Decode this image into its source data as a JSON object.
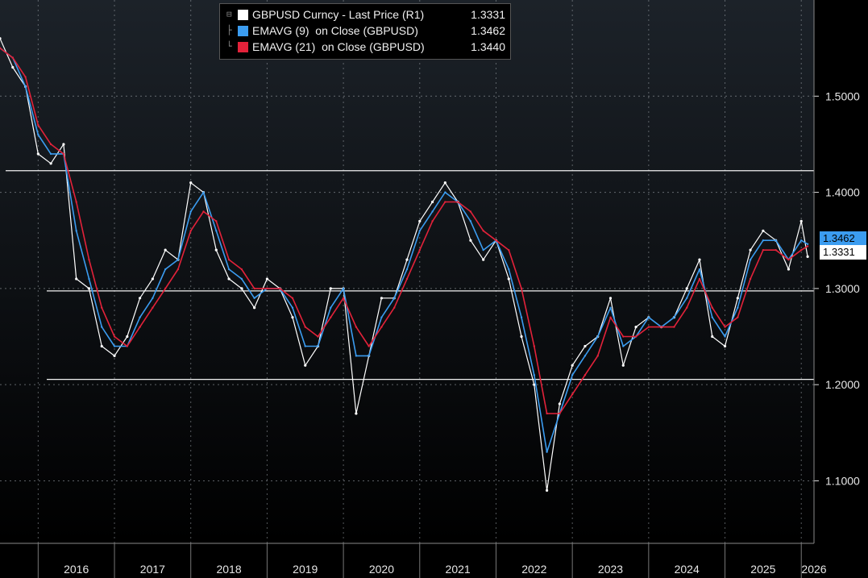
{
  "chart_data": {
    "type": "line",
    "title": "",
    "xlabel": "",
    "ylabel": "",
    "ylim": [
      1.035,
      1.6
    ],
    "xlim": [
      "2015-07",
      "2026-03"
    ],
    "y_ticks": [
      "1.5000",
      "1.4000",
      "1.3000",
      "1.2000",
      "1.1000"
    ],
    "x_ticks": [
      "2016",
      "2017",
      "2018",
      "2019",
      "2020",
      "2021",
      "2022",
      "2023",
      "2024",
      "2025",
      "2026"
    ],
    "grid": true,
    "legend_position": "top-center",
    "colors": {
      "price": "#ffffff",
      "ema9": "#3b9cf0",
      "ema21": "#e3223a",
      "background_top": "#1c2229",
      "background_bottom": "#000000"
    },
    "horizontal_lines": [
      1.4225,
      1.2975,
      1.2055
    ],
    "series": [
      {
        "name": "GBPUSD Curncy - Last Price (R1)",
        "last": "1.3331",
        "points": [
          [
            "2015-07",
            1.56
          ],
          [
            "2015-09",
            1.53
          ],
          [
            "2015-11",
            1.51
          ],
          [
            "2016-01",
            1.44
          ],
          [
            "2016-03",
            1.43
          ],
          [
            "2016-05",
            1.45
          ],
          [
            "2016-07",
            1.31
          ],
          [
            "2016-09",
            1.3
          ],
          [
            "2016-11",
            1.24
          ],
          [
            "2017-01",
            1.23
          ],
          [
            "2017-03",
            1.25
          ],
          [
            "2017-05",
            1.29
          ],
          [
            "2017-07",
            1.31
          ],
          [
            "2017-09",
            1.34
          ],
          [
            "2017-11",
            1.33
          ],
          [
            "2018-01",
            1.41
          ],
          [
            "2018-03",
            1.4
          ],
          [
            "2018-05",
            1.34
          ],
          [
            "2018-07",
            1.31
          ],
          [
            "2018-09",
            1.3
          ],
          [
            "2018-11",
            1.28
          ],
          [
            "2019-01",
            1.31
          ],
          [
            "2019-03",
            1.3
          ],
          [
            "2019-05",
            1.27
          ],
          [
            "2019-07",
            1.22
          ],
          [
            "2019-09",
            1.24
          ],
          [
            "2019-11",
            1.3
          ],
          [
            "2020-01",
            1.3
          ],
          [
            "2020-03",
            1.17
          ],
          [
            "2020-05",
            1.23
          ],
          [
            "2020-07",
            1.29
          ],
          [
            "2020-09",
            1.29
          ],
          [
            "2020-11",
            1.33
          ],
          [
            "2021-01",
            1.37
          ],
          [
            "2021-03",
            1.39
          ],
          [
            "2021-05",
            1.41
          ],
          [
            "2021-07",
            1.39
          ],
          [
            "2021-09",
            1.35
          ],
          [
            "2021-11",
            1.33
          ],
          [
            "2022-01",
            1.35
          ],
          [
            "2022-03",
            1.31
          ],
          [
            "2022-05",
            1.25
          ],
          [
            "2022-07",
            1.2
          ],
          [
            "2022-09",
            1.09
          ],
          [
            "2022-11",
            1.18
          ],
          [
            "2023-01",
            1.22
          ],
          [
            "2023-03",
            1.24
          ],
          [
            "2023-05",
            1.25
          ],
          [
            "2023-07",
            1.29
          ],
          [
            "2023-09",
            1.22
          ],
          [
            "2023-11",
            1.26
          ],
          [
            "2024-01",
            1.27
          ],
          [
            "2024-03",
            1.26
          ],
          [
            "2024-05",
            1.27
          ],
          [
            "2024-07",
            1.3
          ],
          [
            "2024-09",
            1.33
          ],
          [
            "2024-11",
            1.25
          ],
          [
            "2025-01",
            1.24
          ],
          [
            "2025-03",
            1.29
          ],
          [
            "2025-05",
            1.34
          ],
          [
            "2025-07",
            1.36
          ],
          [
            "2025-09",
            1.35
          ],
          [
            "2025-11",
            1.32
          ],
          [
            "2026-01",
            1.37
          ],
          [
            "2026-02",
            1.3331
          ]
        ]
      },
      {
        "name": "EMAVG (9)  on Close (GBPUSD)",
        "last": "1.3462",
        "points": [
          [
            "2015-07",
            1.55
          ],
          [
            "2015-09",
            1.54
          ],
          [
            "2015-11",
            1.51
          ],
          [
            "2016-01",
            1.46
          ],
          [
            "2016-03",
            1.44
          ],
          [
            "2016-05",
            1.44
          ],
          [
            "2016-07",
            1.36
          ],
          [
            "2016-09",
            1.31
          ],
          [
            "2016-11",
            1.26
          ],
          [
            "2017-01",
            1.24
          ],
          [
            "2017-03",
            1.24
          ],
          [
            "2017-05",
            1.27
          ],
          [
            "2017-07",
            1.29
          ],
          [
            "2017-09",
            1.32
          ],
          [
            "2017-11",
            1.33
          ],
          [
            "2018-01",
            1.38
          ],
          [
            "2018-03",
            1.4
          ],
          [
            "2018-05",
            1.36
          ],
          [
            "2018-07",
            1.32
          ],
          [
            "2018-09",
            1.31
          ],
          [
            "2018-11",
            1.29
          ],
          [
            "2019-01",
            1.3
          ],
          [
            "2019-03",
            1.3
          ],
          [
            "2019-05",
            1.28
          ],
          [
            "2019-07",
            1.24
          ],
          [
            "2019-09",
            1.24
          ],
          [
            "2019-11",
            1.28
          ],
          [
            "2020-01",
            1.3
          ],
          [
            "2020-03",
            1.23
          ],
          [
            "2020-05",
            1.23
          ],
          [
            "2020-07",
            1.27
          ],
          [
            "2020-09",
            1.29
          ],
          [
            "2020-11",
            1.32
          ],
          [
            "2021-01",
            1.36
          ],
          [
            "2021-03",
            1.38
          ],
          [
            "2021-05",
            1.4
          ],
          [
            "2021-07",
            1.39
          ],
          [
            "2021-09",
            1.37
          ],
          [
            "2021-11",
            1.34
          ],
          [
            "2022-01",
            1.35
          ],
          [
            "2022-03",
            1.32
          ],
          [
            "2022-05",
            1.27
          ],
          [
            "2022-07",
            1.21
          ],
          [
            "2022-09",
            1.13
          ],
          [
            "2022-11",
            1.17
          ],
          [
            "2023-01",
            1.21
          ],
          [
            "2023-03",
            1.23
          ],
          [
            "2023-05",
            1.25
          ],
          [
            "2023-07",
            1.28
          ],
          [
            "2023-09",
            1.24
          ],
          [
            "2023-11",
            1.25
          ],
          [
            "2024-01",
            1.27
          ],
          [
            "2024-03",
            1.26
          ],
          [
            "2024-05",
            1.27
          ],
          [
            "2024-07",
            1.29
          ],
          [
            "2024-09",
            1.32
          ],
          [
            "2024-11",
            1.27
          ],
          [
            "2025-01",
            1.25
          ],
          [
            "2025-03",
            1.28
          ],
          [
            "2025-05",
            1.33
          ],
          [
            "2025-07",
            1.35
          ],
          [
            "2025-09",
            1.35
          ],
          [
            "2025-11",
            1.33
          ],
          [
            "2026-01",
            1.35
          ],
          [
            "2026-02",
            1.3462
          ]
        ]
      },
      {
        "name": "EMAVG (21)  on Close (GBPUSD)",
        "last": "1.3440",
        "points": [
          [
            "2015-07",
            1.55
          ],
          [
            "2015-09",
            1.54
          ],
          [
            "2015-11",
            1.52
          ],
          [
            "2016-01",
            1.47
          ],
          [
            "2016-03",
            1.45
          ],
          [
            "2016-05",
            1.44
          ],
          [
            "2016-07",
            1.39
          ],
          [
            "2016-09",
            1.33
          ],
          [
            "2016-11",
            1.28
          ],
          [
            "2017-01",
            1.25
          ],
          [
            "2017-03",
            1.24
          ],
          [
            "2017-05",
            1.26
          ],
          [
            "2017-07",
            1.28
          ],
          [
            "2017-09",
            1.3
          ],
          [
            "2017-11",
            1.32
          ],
          [
            "2018-01",
            1.36
          ],
          [
            "2018-03",
            1.38
          ],
          [
            "2018-05",
            1.37
          ],
          [
            "2018-07",
            1.33
          ],
          [
            "2018-09",
            1.32
          ],
          [
            "2018-11",
            1.3
          ],
          [
            "2019-01",
            1.3
          ],
          [
            "2019-03",
            1.3
          ],
          [
            "2019-05",
            1.29
          ],
          [
            "2019-07",
            1.26
          ],
          [
            "2019-09",
            1.25
          ],
          [
            "2019-11",
            1.27
          ],
          [
            "2020-01",
            1.29
          ],
          [
            "2020-03",
            1.26
          ],
          [
            "2020-05",
            1.24
          ],
          [
            "2020-07",
            1.26
          ],
          [
            "2020-09",
            1.28
          ],
          [
            "2020-11",
            1.31
          ],
          [
            "2021-01",
            1.34
          ],
          [
            "2021-03",
            1.37
          ],
          [
            "2021-05",
            1.39
          ],
          [
            "2021-07",
            1.39
          ],
          [
            "2021-09",
            1.38
          ],
          [
            "2021-11",
            1.36
          ],
          [
            "2022-01",
            1.35
          ],
          [
            "2022-03",
            1.34
          ],
          [
            "2022-05",
            1.3
          ],
          [
            "2022-07",
            1.24
          ],
          [
            "2022-09",
            1.17
          ],
          [
            "2022-11",
            1.17
          ],
          [
            "2023-01",
            1.19
          ],
          [
            "2023-03",
            1.21
          ],
          [
            "2023-05",
            1.23
          ],
          [
            "2023-07",
            1.27
          ],
          [
            "2023-09",
            1.25
          ],
          [
            "2023-11",
            1.25
          ],
          [
            "2024-01",
            1.26
          ],
          [
            "2024-03",
            1.26
          ],
          [
            "2024-05",
            1.26
          ],
          [
            "2024-07",
            1.28
          ],
          [
            "2024-09",
            1.31
          ],
          [
            "2024-11",
            1.28
          ],
          [
            "2025-01",
            1.26
          ],
          [
            "2025-03",
            1.27
          ],
          [
            "2025-05",
            1.31
          ],
          [
            "2025-07",
            1.34
          ],
          [
            "2025-09",
            1.34
          ],
          [
            "2025-11",
            1.33
          ],
          [
            "2026-01",
            1.34
          ],
          [
            "2026-02",
            1.344
          ]
        ]
      }
    ]
  },
  "legend": {
    "items": [
      {
        "label": "GBPUSD Curncy - Last Price (R1)",
        "value": "1.3331",
        "color": "#ffffff"
      },
      {
        "label": "EMAVG (9)  on Close (GBPUSD)",
        "value": "1.3462",
        "color": "#3b9cf0"
      },
      {
        "label": "EMAVG (21)  on Close (GBPUSD)",
        "value": "1.3440",
        "color": "#e3223a"
      }
    ]
  },
  "price_tags": {
    "ema9": {
      "value": "1.3462",
      "color": "#3b9cf0"
    },
    "last": {
      "value": "1.3331",
      "color": "#ffffff"
    }
  }
}
